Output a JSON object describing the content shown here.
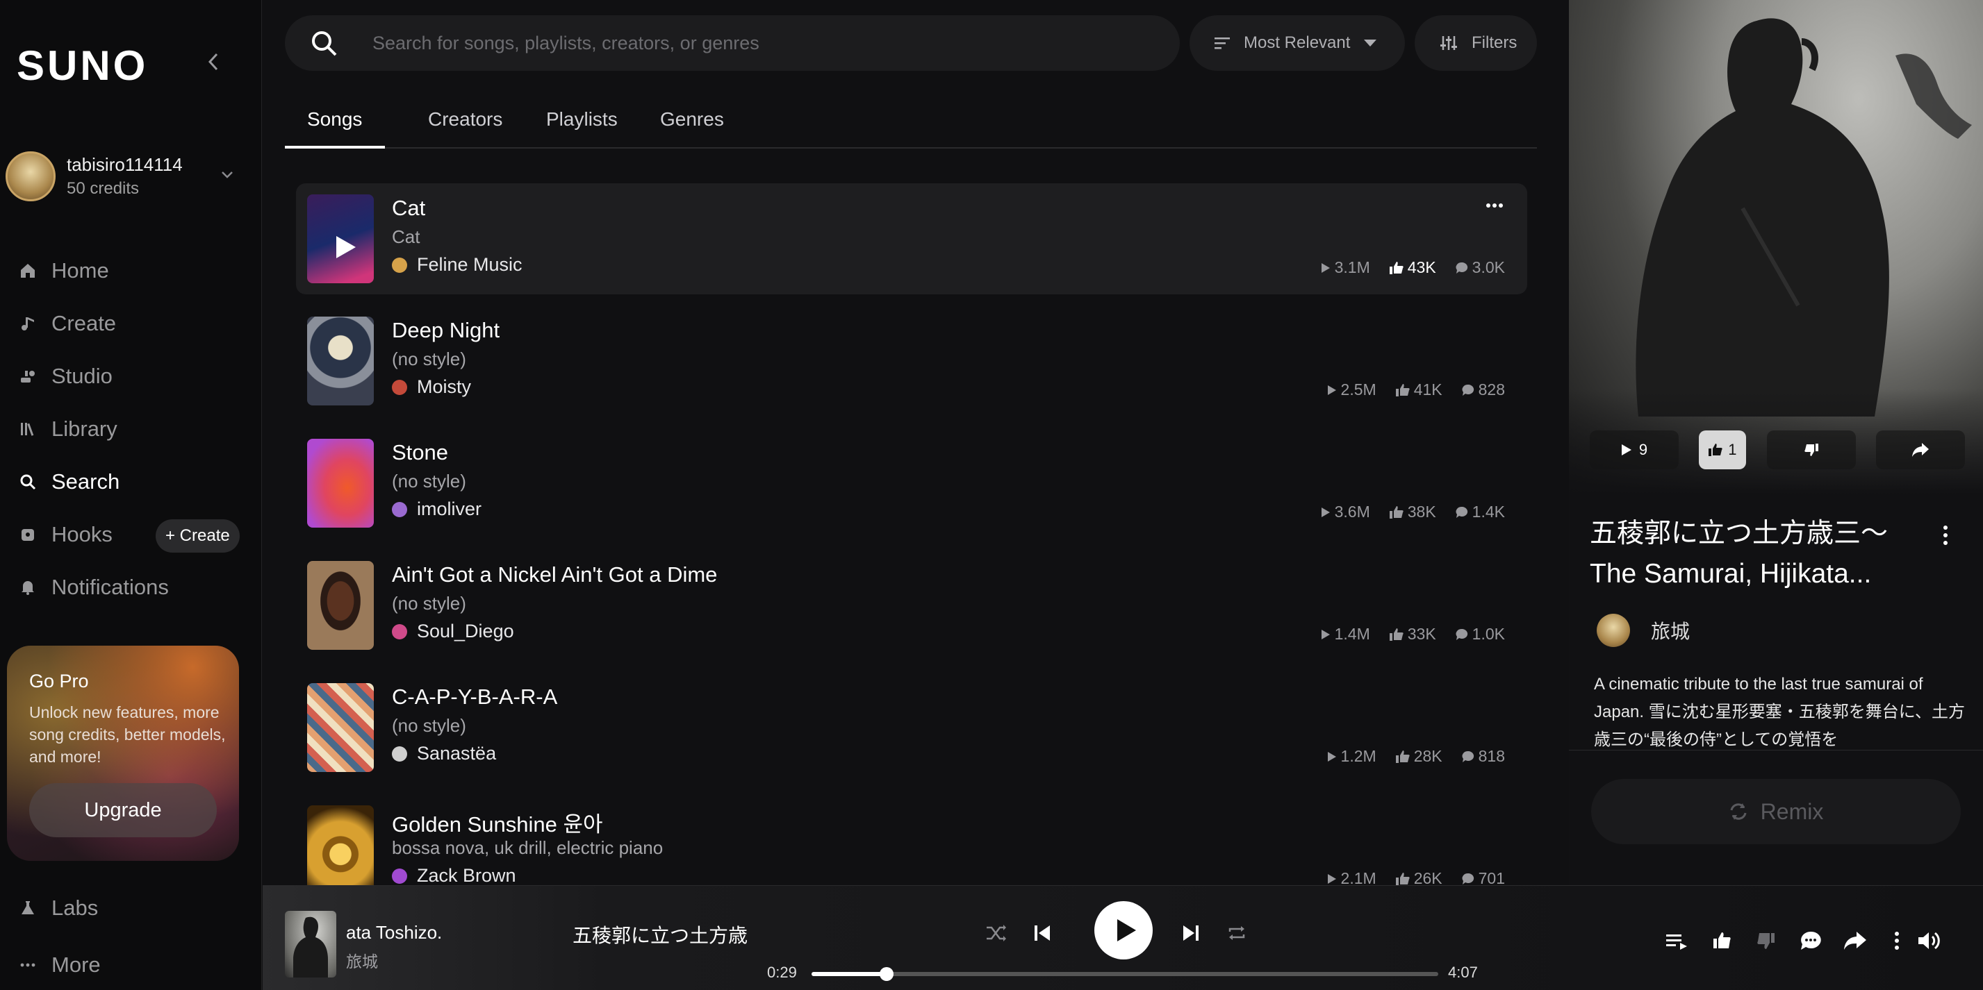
{
  "sidebar": {
    "logo": "SUNO",
    "user": {
      "name": "tabisiro114114",
      "credits": "50 credits"
    },
    "nav": [
      {
        "label": "Home",
        "icon": "home-icon"
      },
      {
        "label": "Create",
        "icon": "music-note-icon"
      },
      {
        "label": "Studio",
        "icon": "studio-icon"
      },
      {
        "label": "Library",
        "icon": "library-icon"
      },
      {
        "label": "Search",
        "icon": "search-icon",
        "active": true
      },
      {
        "label": "Hooks",
        "icon": "hooks-icon",
        "badge": "+ Create"
      },
      {
        "label": "Notifications",
        "icon": "bell-icon"
      }
    ],
    "gopro": {
      "title": "Go Pro",
      "text": "Unlock new features, more song credits, better models, and more!",
      "button": "Upgrade"
    },
    "bottom": [
      {
        "label": "Labs",
        "icon": "flask-icon"
      },
      {
        "label": "More",
        "icon": "ellipsis-icon"
      }
    ]
  },
  "search": {
    "placeholder": "Search for songs, playlists, creators, or genres",
    "value": "",
    "sort": "Most Relevant",
    "filters": "Filters"
  },
  "tabs": [
    "Songs",
    "Creators",
    "Playlists",
    "Genres"
  ],
  "songs": [
    {
      "title": "Cat",
      "style": "Cat",
      "artist": "Feline Music",
      "plays": "3.1M",
      "likes": "43K",
      "comments": "3.0K"
    },
    {
      "title": "Deep Night",
      "style": "(no style)",
      "artist": "Moisty",
      "plays": "2.5M",
      "likes": "41K",
      "comments": "828"
    },
    {
      "title": "Stone",
      "style": "(no style)",
      "artist": "imoliver",
      "plays": "3.6M",
      "likes": "38K",
      "comments": "1.4K"
    },
    {
      "title": "Ain't Got a Nickel Ain't Got a Dime",
      "style": "(no style)",
      "artist": "Soul_Diego",
      "plays": "1.4M",
      "likes": "33K",
      "comments": "1.0K"
    },
    {
      "title": "C-A-P-Y-B-A-R-A",
      "style": "(no style)",
      "artist": "Sanastëa",
      "plays": "1.2M",
      "likes": "28K",
      "comments": "818"
    },
    {
      "title": "Golden Sunshine 윤아",
      "style": "bossa nova, uk drill, electric piano",
      "artist": "Zack Brown",
      "plays": "2.1M",
      "likes": "26K",
      "comments": "701"
    }
  ],
  "panel": {
    "plays": "9",
    "likes": "1",
    "title": "五稜郭に立つ土方歳三〜The Samurai, Hijikata...",
    "artist": "旅城",
    "description": "A cinematic tribute to the last true samurai of Japan. 雪に沈む星形要塞・五稜郭を舞台に、土方歳三の“最後の侍”としての覚悟を",
    "remix": "Remix"
  },
  "player": {
    "title": "ata Toshizo.",
    "artist": "旅城",
    "scroll_title": "五稜郭に立つ土方歳",
    "current": "0:29",
    "duration": "4:07",
    "progress": 0.12
  }
}
